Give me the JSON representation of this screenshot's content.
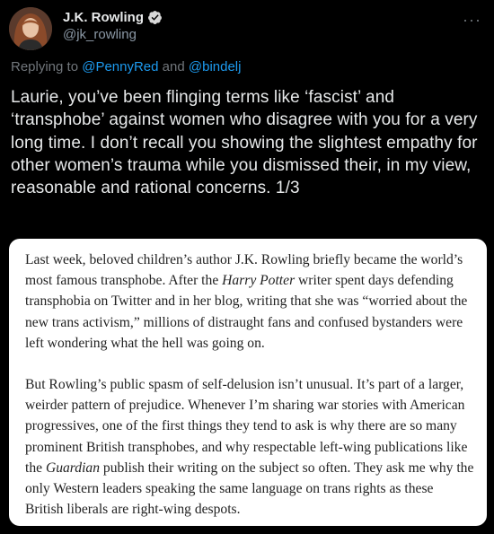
{
  "author": {
    "display_name": "J.K. Rowling",
    "handle": "@jk_rowling",
    "verified": true,
    "avatar_icon": "avatar-photo"
  },
  "more_icon": "more-options-icon",
  "reply": {
    "prefix": "Replying to ",
    "mention1": "@PennyRed",
    "connector": " and ",
    "mention2": "@bindelj"
  },
  "tweet_text": "Laurie, you’ve been flinging terms like ‘fascist’ and ‘transphobe’ against women who disagree with you for a very long time. I don’t recall you showing the slightest empathy for other women’s trauma while you dismissed their, in my view, reasonable and rational concerns. 1/3",
  "quoted_article": {
    "para1": {
      "before": "Last week, beloved children’s author J.K. Rowling briefly became the world’s most famous transphobe. After the ",
      "italic": "Harry Potter",
      "after": " writer spent days defending transphobia on Twitter and in her blog, writing that she was “worried about the new trans activism,” millions of distraught fans and confused bystanders were left wondering what the hell was going on."
    },
    "para2": {
      "before": "But Rowling’s public spasm of self-delusion isn’t unusual. It’s part of a larger, weirder pattern of prejudice. Whenever I’m sharing war stories with American progressives, one of the first things they tend to ask is why there are so many prominent British transphobes, and why respectable left-wing publications like the ",
      "italic": "Guardian",
      "after": " publish their writing on the subject so often. They ask me why the only Western leaders speaking the same language on trans rights as these British liberals are right-wing despots."
    }
  },
  "colors": {
    "background": "#000000",
    "text": "#e7e9ea",
    "secondary": "#71767b",
    "link": "#1d9bf0",
    "verified": "#1d9bf0"
  }
}
